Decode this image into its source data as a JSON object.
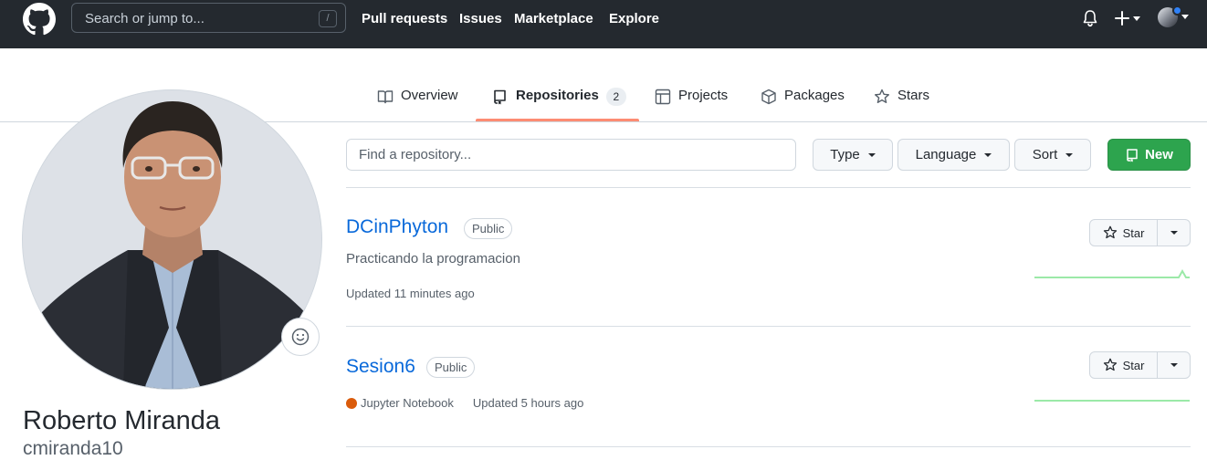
{
  "header": {
    "search_placeholder": "Search or jump to...",
    "search_shortcut": "/",
    "nav": [
      "Pull requests",
      "Issues",
      "Marketplace",
      "Explore"
    ]
  },
  "tabs": [
    {
      "label": "Overview",
      "icon": "book-icon"
    },
    {
      "label": "Repositories",
      "icon": "repo-icon",
      "count": "2",
      "active": true
    },
    {
      "label": "Projects",
      "icon": "table-icon"
    },
    {
      "label": "Packages",
      "icon": "package-icon"
    },
    {
      "label": "Stars",
      "icon": "star-icon"
    }
  ],
  "profile": {
    "name": "Roberto Miranda",
    "login": "cmiranda10"
  },
  "filters": {
    "find_placeholder": "Find a repository...",
    "type_label": "Type",
    "language_label": "Language",
    "sort_label": "Sort",
    "new_label": "New"
  },
  "repos": [
    {
      "name": "DCinPhyton",
      "visibility": "Public",
      "description": "Practicando la programacion",
      "updated": "Updated 11 minutes ago",
      "star_label": "Star"
    },
    {
      "name": "Sesion6",
      "visibility": "Public",
      "language": "Jupyter Notebook",
      "updated": "Updated 5 hours ago",
      "star_label": "Star"
    }
  ],
  "colors": {
    "header_bg": "#24292f",
    "link": "#0969da",
    "tab_underline": "#fd8c73",
    "new_button": "#2da44e",
    "jupyter": "#da5b0b",
    "sparkline": "#9be9a8"
  }
}
